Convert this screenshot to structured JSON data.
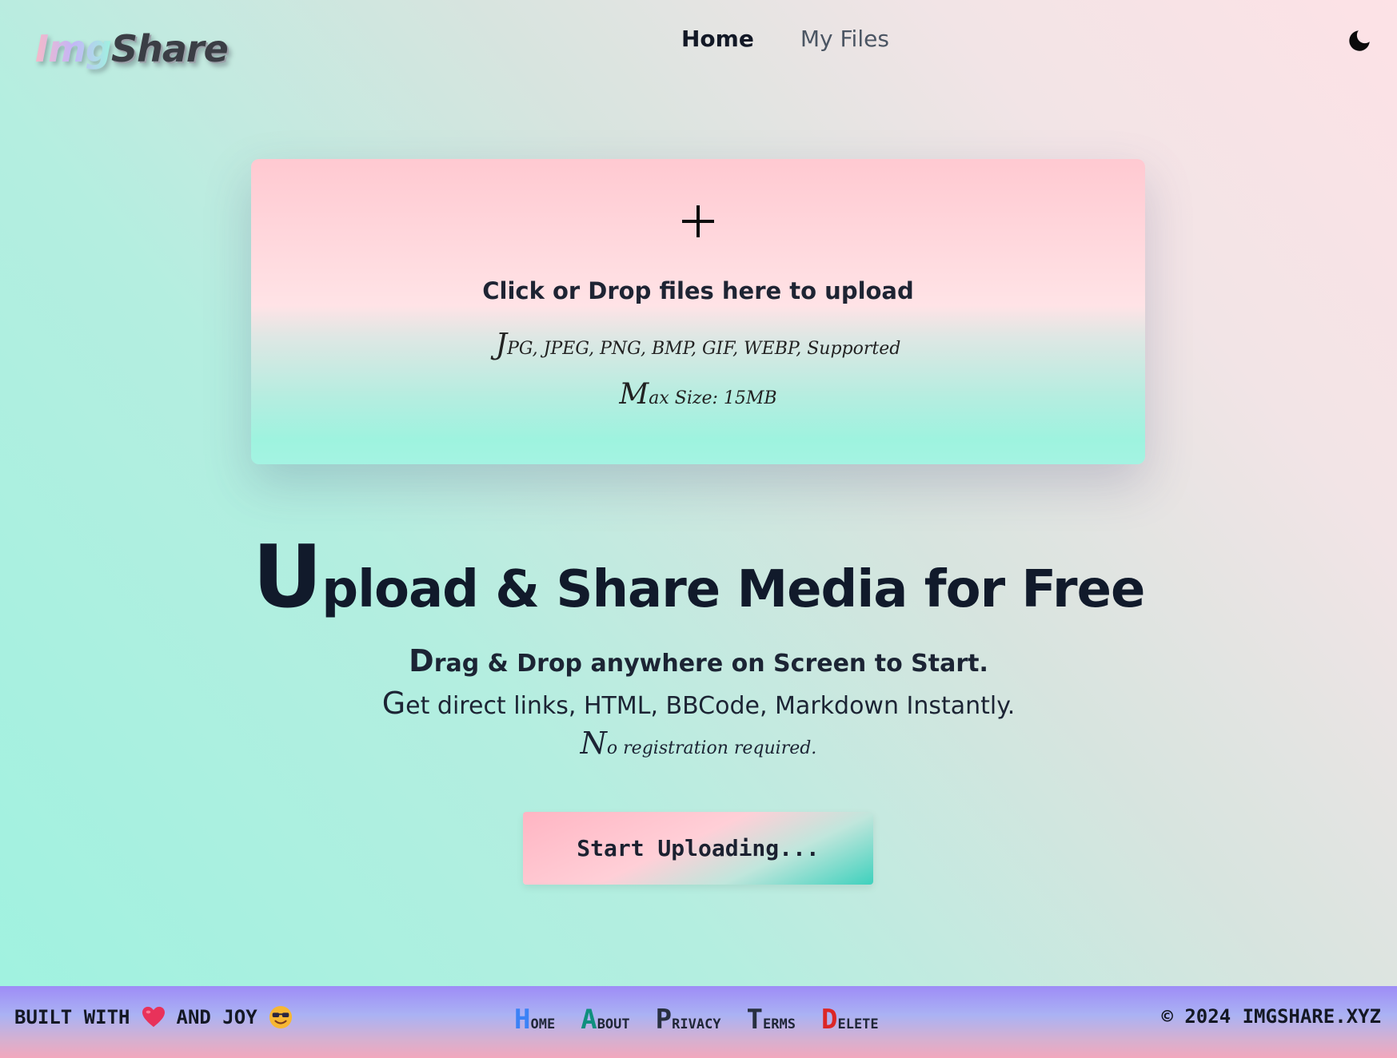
{
  "header": {
    "logo_part1": "Img",
    "logo_part2": "Share",
    "nav": {
      "home_label": "Home",
      "files_label": "My Files"
    },
    "theme_icon": "moon-icon"
  },
  "upload": {
    "plus_icon": "plus-icon",
    "title": "Click or Drop files here to upload",
    "formats": "JPG, JPEG, PNG, BMP, GIF, WEBP, Supported",
    "max_size": "Max Size: 15MB"
  },
  "hero": {
    "title": "Upload & Share Media for Free",
    "line1": "Drag & Drop anywhere on Screen to Start.",
    "line2": "Get direct links, HTML, BBCode, Markdown Instantly.",
    "line3": "No registration required.",
    "cta_label": "Start Uploading..."
  },
  "footer": {
    "left_part1": "BUILT WITH",
    "left_part2": "AND JOY",
    "heart_icon": "heart-icon",
    "smile_icon": "sunglasses-smile-icon",
    "links": [
      {
        "cap": "H",
        "rest": "ome"
      },
      {
        "cap": "A",
        "rest": "bout"
      },
      {
        "cap": "P",
        "rest": "rivacy"
      },
      {
        "cap": "T",
        "rest": "erms"
      },
      {
        "cap": "D",
        "rest": "elete"
      }
    ],
    "copyright": "© 2024 IMGSHARE.XYZ"
  },
  "colors": {
    "footer_home": "#3b82f6",
    "footer_about": "#0f8f7e",
    "footer_delete": "#dc2626",
    "text_dark": "#111a2b"
  }
}
